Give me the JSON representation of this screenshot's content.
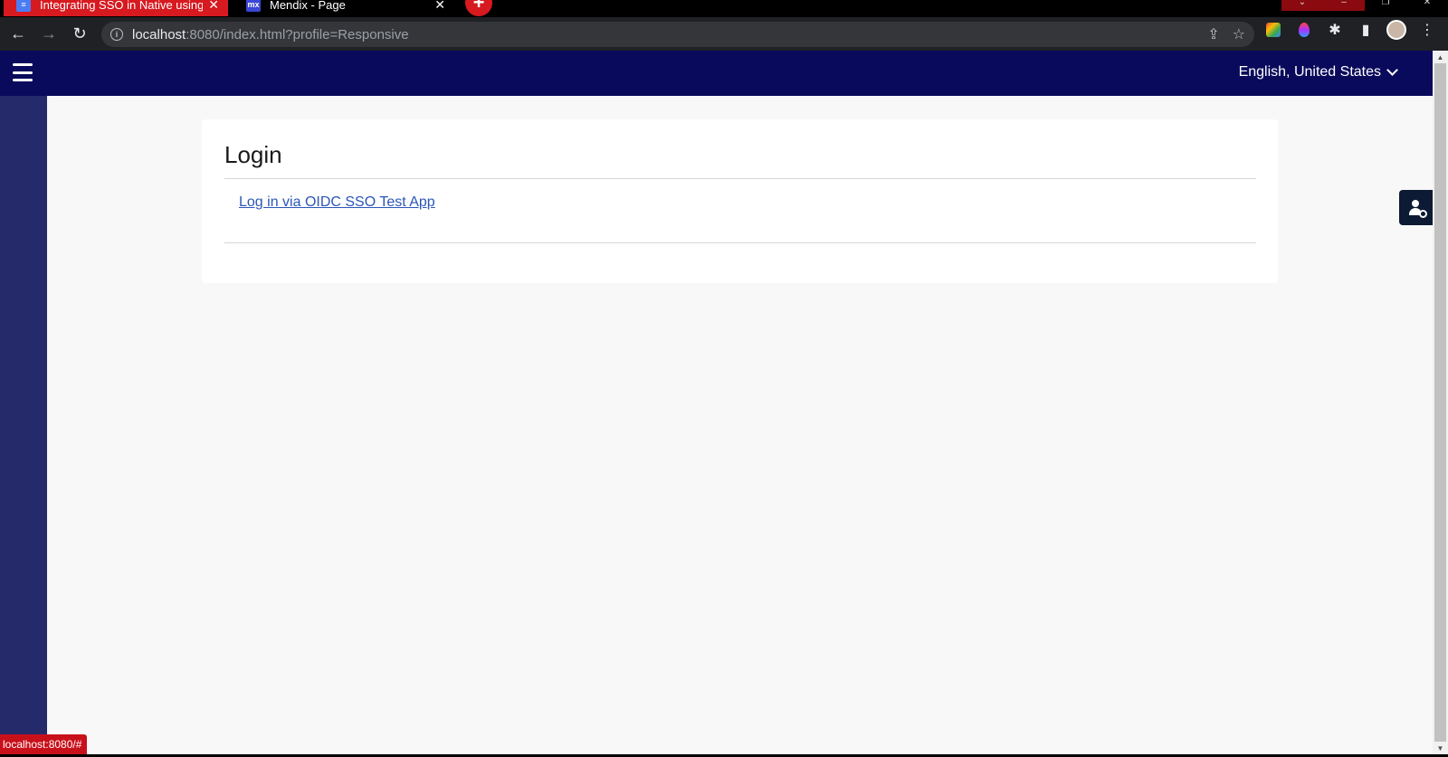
{
  "browser": {
    "tabs": [
      {
        "title": "Integrating SSO in Native using OIDC",
        "favicon": "docs-icon",
        "active": false
      },
      {
        "title": "Mendix - Page",
        "favicon": "mx",
        "active": true
      }
    ],
    "close_glyph": "✕",
    "new_tab_glyph": "+",
    "address": {
      "host": "localhost",
      "rest": ":8080/index.html?profile=Responsive"
    },
    "status_url": "localhost:8080/#"
  },
  "app": {
    "header": {
      "language": "English, United States"
    },
    "login": {
      "title": "Login",
      "link_label": "Log in via OIDC SSO Test App"
    }
  },
  "colors": {
    "header_bg": "#0a0a5c",
    "sidebar_bg": "#252a6b",
    "link": "#2b56b8",
    "tab_active_red": "#d71920"
  }
}
